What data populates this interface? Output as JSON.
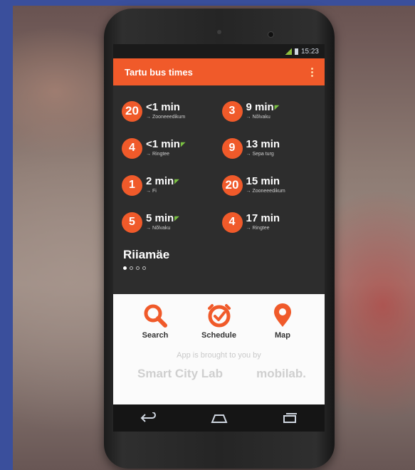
{
  "status_bar": {
    "time": "15:23"
  },
  "app_bar": {
    "title": "Tartu bus times"
  },
  "departures": [
    {
      "route": "20",
      "time": "<1 min",
      "live": false,
      "destination": "→ Zooneeedikum"
    },
    {
      "route": "3",
      "time": "9 min",
      "live": true,
      "destination": "→ Nõlvaku"
    },
    {
      "route": "4",
      "time": "<1 min",
      "live": true,
      "destination": "→ Ringtee"
    },
    {
      "route": "9",
      "time": "13 min",
      "live": false,
      "destination": "→ Sepa turg"
    },
    {
      "route": "1",
      "time": "2 min",
      "live": true,
      "destination": "→ Fi"
    },
    {
      "route": "20",
      "time": "15 min",
      "live": false,
      "destination": "→ Zooneeedikum"
    },
    {
      "route": "5",
      "time": "5 min",
      "live": true,
      "destination": "→ Nõlvaku"
    },
    {
      "route": "4",
      "time": "17 min",
      "live": false,
      "destination": "→ Ringtee"
    }
  ],
  "stop_name": "Riiamäe",
  "page_indicator": {
    "total": 4,
    "active": 1
  },
  "actions": [
    {
      "label": "Search",
      "icon": "search-icon"
    },
    {
      "label": "Schedule",
      "icon": "clock-icon"
    },
    {
      "label": "Map",
      "icon": "map-pin-icon"
    }
  ],
  "credit": "App is brought to you by",
  "sponsors": [
    "Smart City Lab",
    "mobilab."
  ],
  "colors": {
    "accent": "#f05a2a",
    "live": "#7ac142",
    "screen_bg": "#2d2d2d"
  }
}
